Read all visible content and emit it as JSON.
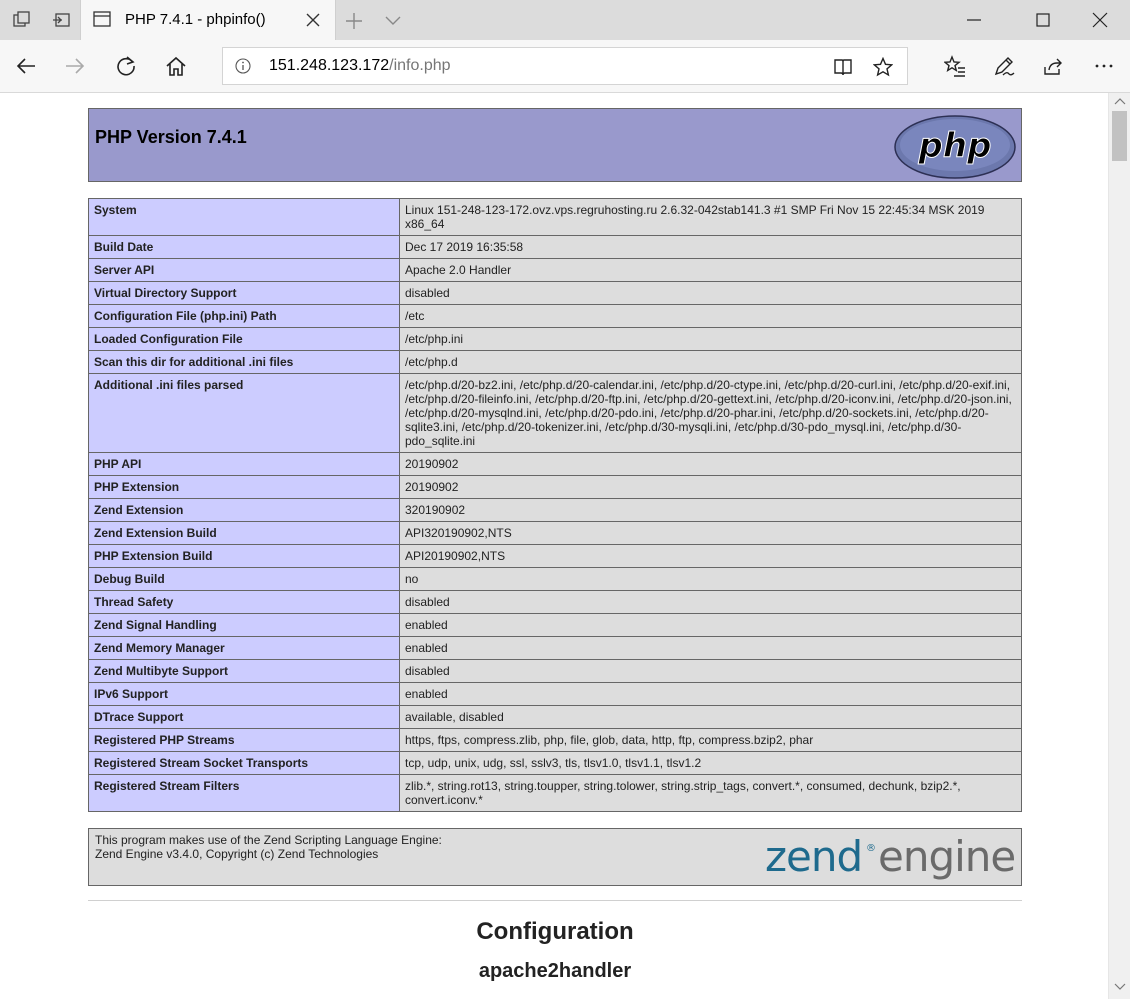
{
  "browser": {
    "tab_title": "PHP 7.4.1 - phpinfo()",
    "address_host": "151.248.123.172",
    "address_path": "/info.php"
  },
  "header": {
    "title": "PHP Version 7.4.1",
    "logo_text": "php"
  },
  "rows": [
    {
      "key": "System",
      "value": "Linux 151-248-123-172.ovz.vps.regruhosting.ru 2.6.32-042stab141.3 #1 SMP Fri Nov 15 22:45:34 MSK 2019 x86_64"
    },
    {
      "key": "Build Date",
      "value": "Dec 17 2019 16:35:58"
    },
    {
      "key": "Server API",
      "value": "Apache 2.0 Handler"
    },
    {
      "key": "Virtual Directory Support",
      "value": "disabled"
    },
    {
      "key": "Configuration File (php.ini) Path",
      "value": "/etc"
    },
    {
      "key": "Loaded Configuration File",
      "value": "/etc/php.ini"
    },
    {
      "key": "Scan this dir for additional .ini files",
      "value": "/etc/php.d"
    },
    {
      "key": "Additional .ini files parsed",
      "value": "/etc/php.d/20-bz2.ini, /etc/php.d/20-calendar.ini, /etc/php.d/20-ctype.ini, /etc/php.d/20-curl.ini, /etc/php.d/20-exif.ini, /etc/php.d/20-fileinfo.ini, /etc/php.d/20-ftp.ini, /etc/php.d/20-gettext.ini, /etc/php.d/20-iconv.ini, /etc/php.d/20-json.ini, /etc/php.d/20-mysqlnd.ini, /etc/php.d/20-pdo.ini, /etc/php.d/20-phar.ini, /etc/php.d/20-sockets.ini, /etc/php.d/20-sqlite3.ini, /etc/php.d/20-tokenizer.ini, /etc/php.d/30-mysqli.ini, /etc/php.d/30-pdo_mysql.ini, /etc/php.d/30-pdo_sqlite.ini"
    },
    {
      "key": "PHP API",
      "value": "20190902"
    },
    {
      "key": "PHP Extension",
      "value": "20190902"
    },
    {
      "key": "Zend Extension",
      "value": "320190902"
    },
    {
      "key": "Zend Extension Build",
      "value": "API320190902,NTS"
    },
    {
      "key": "PHP Extension Build",
      "value": "API20190902,NTS"
    },
    {
      "key": "Debug Build",
      "value": "no"
    },
    {
      "key": "Thread Safety",
      "value": "disabled"
    },
    {
      "key": "Zend Signal Handling",
      "value": "enabled"
    },
    {
      "key": "Zend Memory Manager",
      "value": "enabled"
    },
    {
      "key": "Zend Multibyte Support",
      "value": "disabled"
    },
    {
      "key": "IPv6 Support",
      "value": "enabled"
    },
    {
      "key": "DTrace Support",
      "value": "available, disabled"
    },
    {
      "key": "Registered PHP Streams",
      "value": "https, ftps, compress.zlib, php, file, glob, data, http, ftp, compress.bzip2, phar"
    },
    {
      "key": "Registered Stream Socket Transports",
      "value": "tcp, udp, unix, udg, ssl, sslv3, tls, tlsv1.0, tlsv1.1, tlsv1.2"
    },
    {
      "key": "Registered Stream Filters",
      "value": "zlib.*, string.rot13, string.toupper, string.tolower, string.strip_tags, convert.*, consumed, dechunk, bzip2.*, convert.iconv.*"
    }
  ],
  "zend": {
    "line1": "This program makes use of the Zend Scripting Language Engine:",
    "line2": "Zend Engine v3.4.0, Copyright (c) Zend Technologies",
    "logo_word1": "zend",
    "logo_word2": "engine",
    "logo_mark": "®"
  },
  "sections": {
    "configuration": "Configuration",
    "apache": "apache2handler"
  },
  "colors": {
    "header_bg": "#9999cc",
    "key_bg": "#ccccff",
    "value_bg": "#dddddd",
    "zend_blue": "#1e6a8d",
    "zend_gray": "#6a6a6a"
  }
}
